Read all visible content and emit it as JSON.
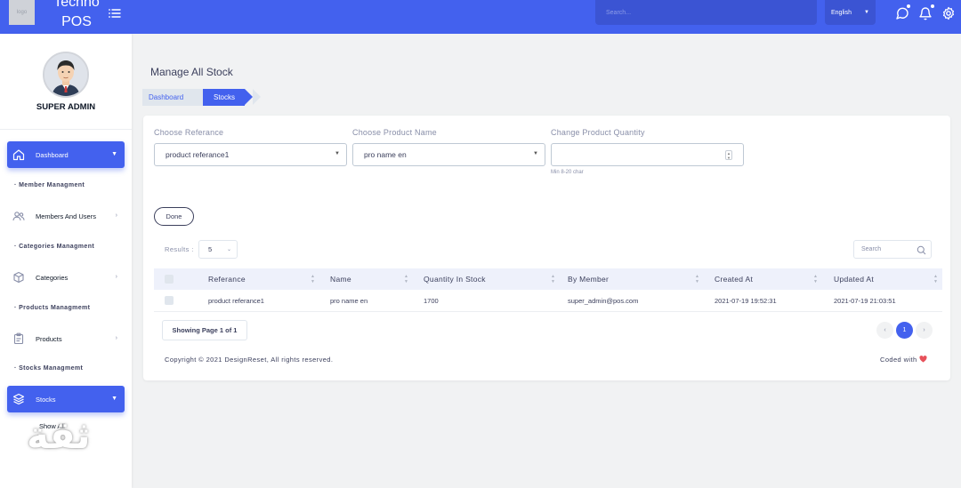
{
  "app": {
    "brand": "Techno POS",
    "logo_text": "logo"
  },
  "topbar": {
    "search_placeholder": "Search...",
    "language": "English"
  },
  "sidebar": {
    "user_name": "SUPER ADMIN",
    "items": [
      {
        "label": "Dashboard"
      },
      {
        "section": "Member Managment"
      },
      {
        "label": "Members And Users"
      },
      {
        "section": "Categories Managment"
      },
      {
        "label": "Categories"
      },
      {
        "section": "Products Managmemt"
      },
      {
        "label": "Products"
      },
      {
        "section": "Stocks Managmemt"
      },
      {
        "label": "Stocks"
      }
    ],
    "sub_item": "Show All",
    "watermark": "ثقة"
  },
  "page": {
    "title": "Manage All Stock",
    "breadcrumb": [
      "Dashboard",
      "Stocks"
    ]
  },
  "form": {
    "reference_label": "Choose Referance",
    "reference_value": "product referance1",
    "product_label": "Choose Product Name",
    "product_value": "pro name en",
    "quantity_label": "Change Product Quantity",
    "quantity_value": "",
    "quantity_hint": "Min 8-20 char",
    "done_label": "Done"
  },
  "table": {
    "results_label": "Results :",
    "results_value": "5",
    "search_placeholder": "Search",
    "columns": [
      "Referance",
      "Name",
      "Quantity In Stock",
      "By Member",
      "Created At",
      "Updated At"
    ],
    "rows": [
      [
        "product referance1",
        "pro name en",
        "1700",
        "super_admin@pos.com",
        "2021-07-19 19:52:31",
        "2021-07-19 21:03:51"
      ]
    ],
    "showing": "Showing Page 1 of 1",
    "pages": [
      "‹",
      "1",
      "›"
    ]
  },
  "footer": {
    "copyright": "Copyright © 2021 DesignReset, All rights reserved.",
    "coded": "Coded with",
    "heart_color": "#e7515a"
  },
  "colors": {
    "primary": "#4361ee",
    "text": "#3b3f5c",
    "muted": "#888ea8"
  }
}
